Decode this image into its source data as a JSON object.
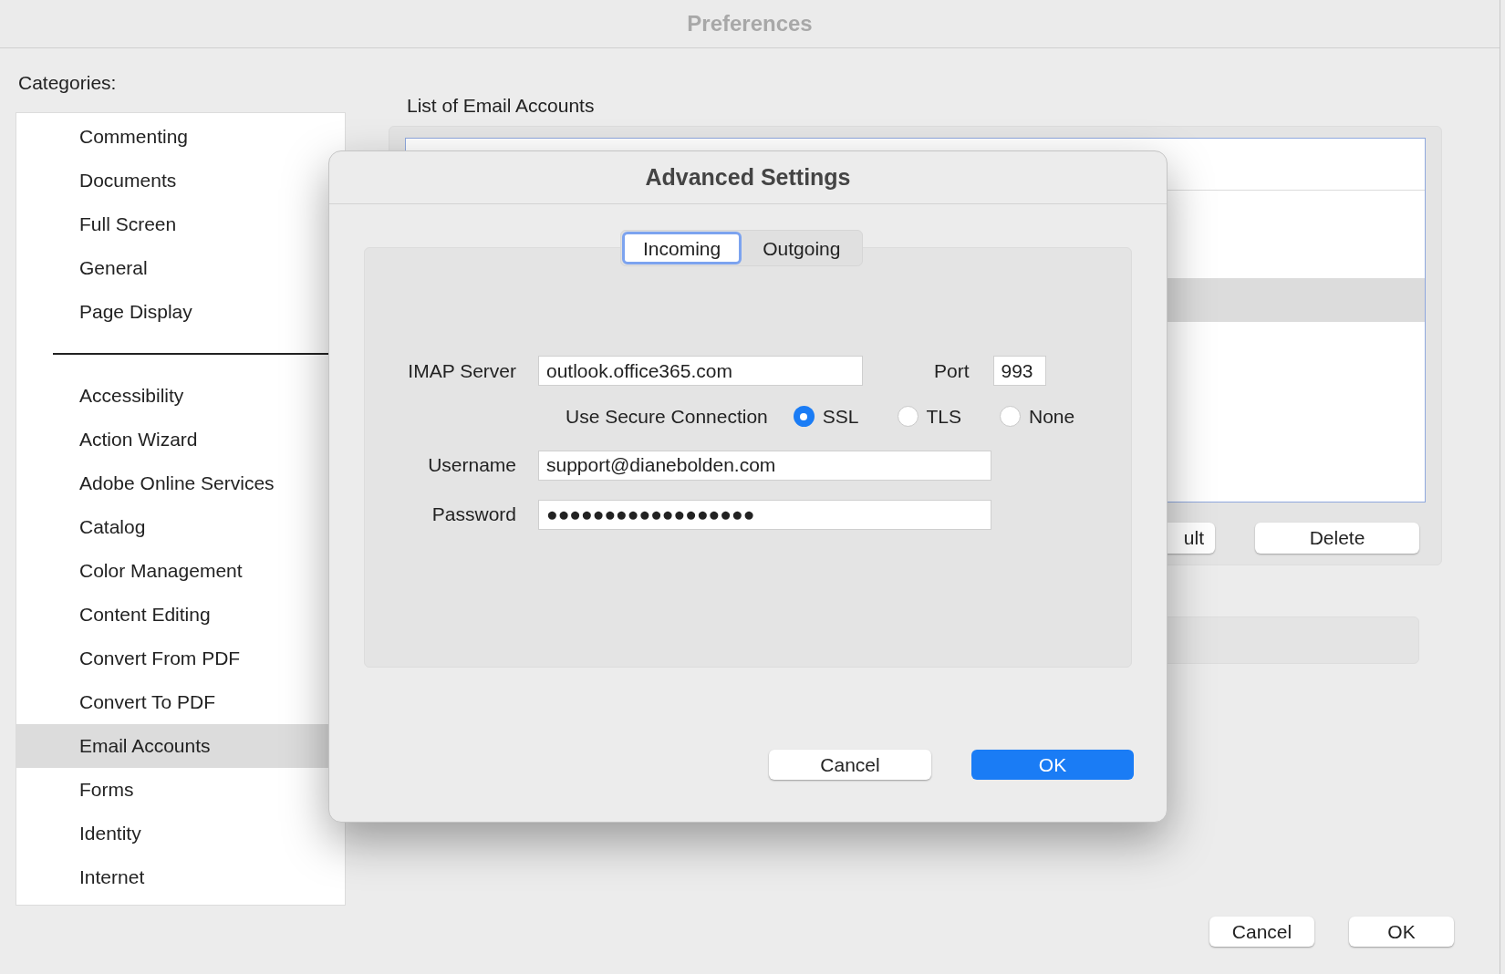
{
  "window": {
    "title": "Preferences"
  },
  "sidebar": {
    "label": "Categories:",
    "groups": [
      [
        {
          "label": "Commenting",
          "selected": false
        },
        {
          "label": "Documents",
          "selected": false
        },
        {
          "label": "Full Screen",
          "selected": false
        },
        {
          "label": "General",
          "selected": false
        },
        {
          "label": "Page Display",
          "selected": false
        }
      ],
      [
        {
          "label": "Accessibility",
          "selected": false
        },
        {
          "label": "Action Wizard",
          "selected": false
        },
        {
          "label": "Adobe Online Services",
          "selected": false
        },
        {
          "label": "Catalog",
          "selected": false
        },
        {
          "label": "Color Management",
          "selected": false
        },
        {
          "label": "Content Editing",
          "selected": false
        },
        {
          "label": "Convert From PDF",
          "selected": false
        },
        {
          "label": "Convert To PDF",
          "selected": false
        },
        {
          "label": "Email Accounts",
          "selected": true
        },
        {
          "label": "Forms",
          "selected": false
        },
        {
          "label": "Identity",
          "selected": false
        },
        {
          "label": "Internet",
          "selected": false
        }
      ]
    ]
  },
  "email_accounts": {
    "label": "List of Email Accounts",
    "buttons": [
      "ult",
      "Delete"
    ]
  },
  "buttons": [
    "Cancel",
    "OK"
  ],
  "dialog": {
    "title": "Advanced Settings",
    "tabs": [
      {
        "label": "Incoming",
        "selected": true
      },
      {
        "label": "Outgoing",
        "selected": false
      }
    ],
    "server": {
      "label": "IMAP Server",
      "value": "outlook.office365.com"
    },
    "port": {
      "label": "Port",
      "value": "993"
    },
    "secure": {
      "label": "Use Secure Connection",
      "options": [
        {
          "label": "SSL",
          "selected": true
        },
        {
          "label": "TLS",
          "selected": false
        },
        {
          "label": "None",
          "selected": false
        }
      ]
    },
    "username": {
      "label": "Username",
      "value": "support@dianebolden.com"
    },
    "password": {
      "label": "Password",
      "value": "●●●●●●●●●●●●●●●●●●"
    },
    "buttons": [
      {
        "label": "Cancel",
        "default": false
      },
      {
        "label": "OK",
        "default": true
      }
    ]
  }
}
